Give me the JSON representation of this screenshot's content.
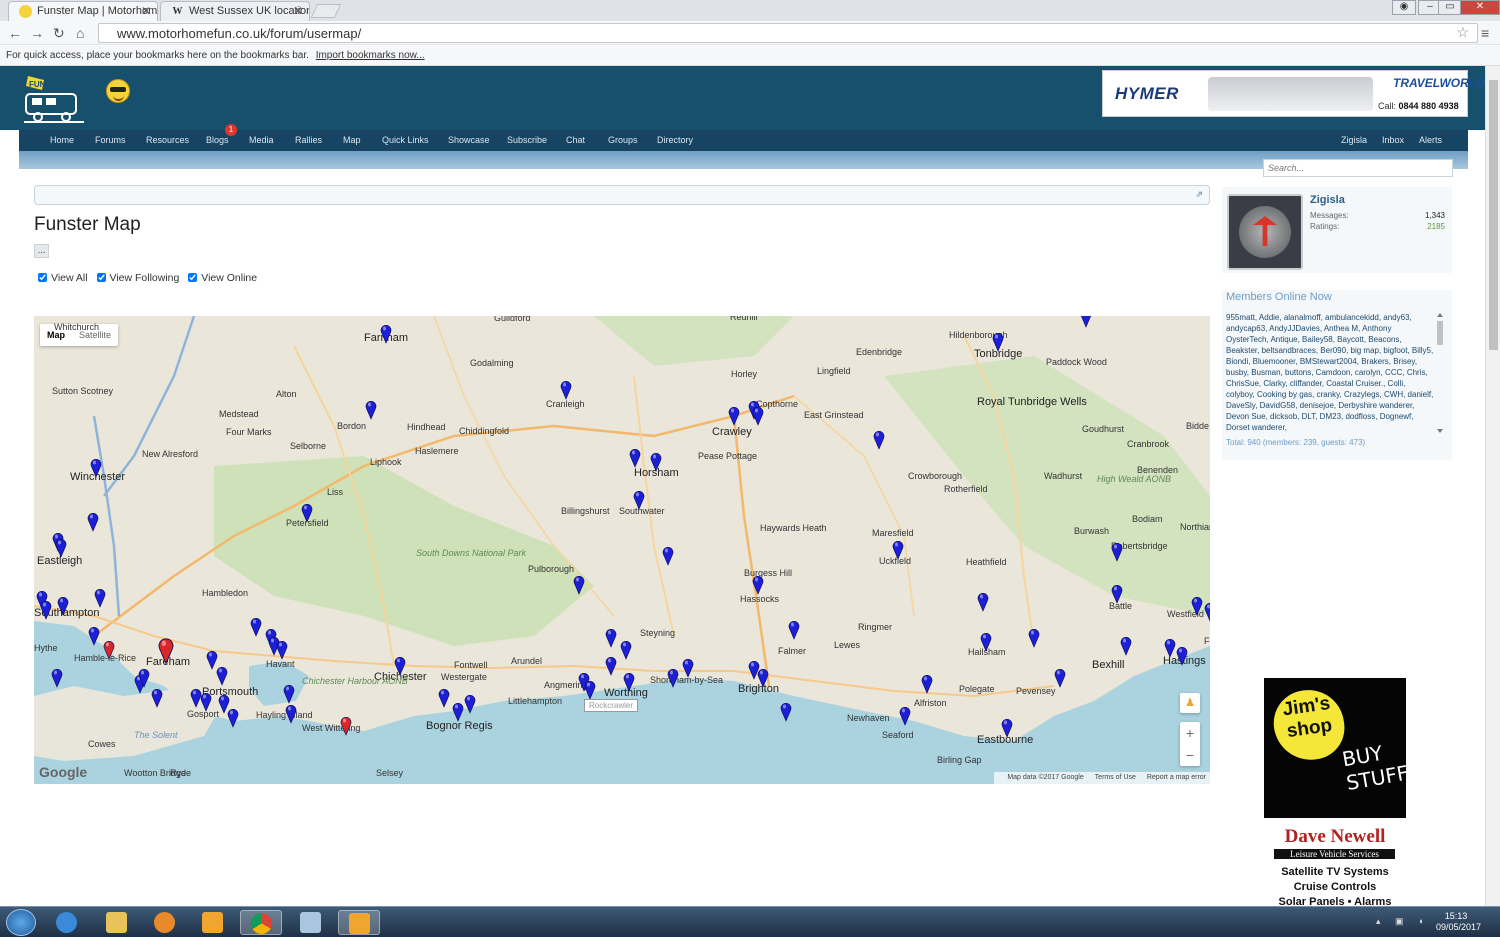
{
  "browser": {
    "tabs": [
      {
        "title": "Funster Map | Motorhome",
        "icon": "smiley-favicon"
      },
      {
        "title": "West Sussex UK location",
        "icon": "wikipedia-favicon"
      }
    ],
    "url": "www.motorhomefun.co.uk/forum/usermap/",
    "bookmarks_text": "For quick access, place your bookmarks here on the bookmarks bar.",
    "bookmarks_link": "Import bookmarks now..."
  },
  "banner": {
    "brand": "HYMER",
    "dealer": "TRAVELWORLD",
    "call_label": "Call:",
    "phone": "0844 880 4938"
  },
  "nav": {
    "items": [
      "Home",
      "Forums",
      "Resources",
      "Blogs",
      "Media",
      "Rallies",
      "Map",
      "Quick Links",
      "Showcase",
      "Subscribe",
      "Chat",
      "Groups",
      "Directory"
    ],
    "right": [
      "Zigisla",
      "Inbox",
      "Alerts"
    ],
    "blogs_badge": "1"
  },
  "search": {
    "placeholder": "Search..."
  },
  "page": {
    "title": "Funster Map",
    "dots": "...",
    "checks": [
      {
        "label": "View All",
        "checked": true
      },
      {
        "label": "View Following",
        "checked": true
      },
      {
        "label": "View Online",
        "checked": true
      }
    ]
  },
  "map": {
    "type_map": "Map",
    "type_satellite": "Satellite",
    "logo": "Google",
    "footer": [
      "Map data ©2017 Google",
      "Terms of Use",
      "Report a map error"
    ],
    "tooltip": "Rockcrawler",
    "zoom_in": "+",
    "zoom_out": "−",
    "places": [
      "Whitchurch",
      "Guildford",
      "Farnham",
      "Godalming",
      "Redhill",
      "Hildenborough",
      "Tonbridge",
      "Edenbridge",
      "Paddock Wood",
      "Horley",
      "Lingfield",
      "Sutton Scotney",
      "Alton",
      "Medstead",
      "Four Marks",
      "Bordon",
      "Hindhead",
      "Chiddingfold",
      "Cranleigh",
      "Crawley",
      "Copthorne",
      "East Grinstead",
      "Royal Tunbridge Wells",
      "Goudhurst",
      "Bidde",
      "Selborne",
      "New Alresford",
      "Liphook",
      "Haslemere",
      "Horsham",
      "Pease Pottage",
      "Cranbrook",
      "Winchester",
      "Liss",
      "Crowborough",
      "Rotherfield",
      "Wadhurst",
      "Benenden",
      "Petersfield",
      "Billingshurst",
      "Southwater",
      "Haywards Heath",
      "High Weald AONB",
      "Burwash",
      "Bodiam",
      "Northiam",
      "Eastleigh",
      "South Downs National Park",
      "Pulborough",
      "Maresfield",
      "Uckfield",
      "Heathfield",
      "Robertsbridge",
      "Burgess Hill",
      "Hambledon",
      "Hassocks",
      "Battle",
      "Westfield",
      "Southampton",
      "Hythe",
      "Hamble-le-Rice",
      "Fareham",
      "Havant",
      "Chichester",
      "Steyning",
      "Ringmer",
      "Hailsham",
      "Lewes",
      "Falmer",
      "Fontwell",
      "Westergate",
      "Arundel",
      "Angmering",
      "Worthing",
      "Shoreham-by-Sea",
      "Brighton",
      "Bexhill",
      "Hastings",
      "Portsmouth",
      "Gosport",
      "Chichester Harbour AONB",
      "Hayling Island",
      "Bognor Regis",
      "Littlehampton",
      "Pevensey",
      "Polegate",
      "Alfriston",
      "Newhaven",
      "Seaford",
      "Eastbourne",
      "Birling Gap",
      "West Wittering",
      "Cowes",
      "The Solent",
      "Wootton Bridge",
      "Ryde",
      "Selsey",
      "Fa"
    ],
    "pins_blue_count": 72,
    "pins_red_count": 3
  },
  "profile": {
    "name": "Zigisla",
    "messages_label": "Messages:",
    "messages": "1,343",
    "ratings_label": "Ratings:",
    "ratings": "2185"
  },
  "online": {
    "title": "Members Online Now",
    "list": "955matt, Addie, alanalmoff, ambulancekidd, andy63, andycap63, AndyJJDavies, Anthea M, Anthony OysterTech, Antique, Bailey58, Baycott, Beacons, Beakster, beltsandbraces, Ber090, big map, bigfoot, Billy5, Biondi, Bluemooner, BMStewart2004, Brakers, Brisey, busby, Busman, buttons, Camdoon, carolyn, CCC, Chris, ChrisSue, Clarky, cliffander, Coastal Cruiser., Colli, colyboy, Cooking by gas, cranky, Crazylegs, CWH, danielf, DaveSly, DavidG58, denisejoe, Derbyshire wanderer, Devon Sue, dicksob, DLT, DM23, dodfloss, Dognewf, Dorset wanderer,",
    "total": "Total: 940 (members: 239, guests: 473)"
  },
  "ad": {
    "jims": "Jim's shop",
    "buy": "BUY STUFF",
    "company": "Dave Newell",
    "sub": "Leisure Vehicle Services",
    "lines": [
      "Satellite TV Systems",
      "Cruise Controls",
      "Solar Panels • Alarms"
    ]
  },
  "taskbar": {
    "time": "15:13",
    "date": "09/05/2017"
  },
  "colors": {
    "header": "#17506d",
    "nav": "#174462",
    "sea": "#aad3df",
    "land": "#e8e5da",
    "park": "#c6ddb0",
    "pin_blue": "#1c1fd6",
    "pin_red": "#d8262a"
  }
}
